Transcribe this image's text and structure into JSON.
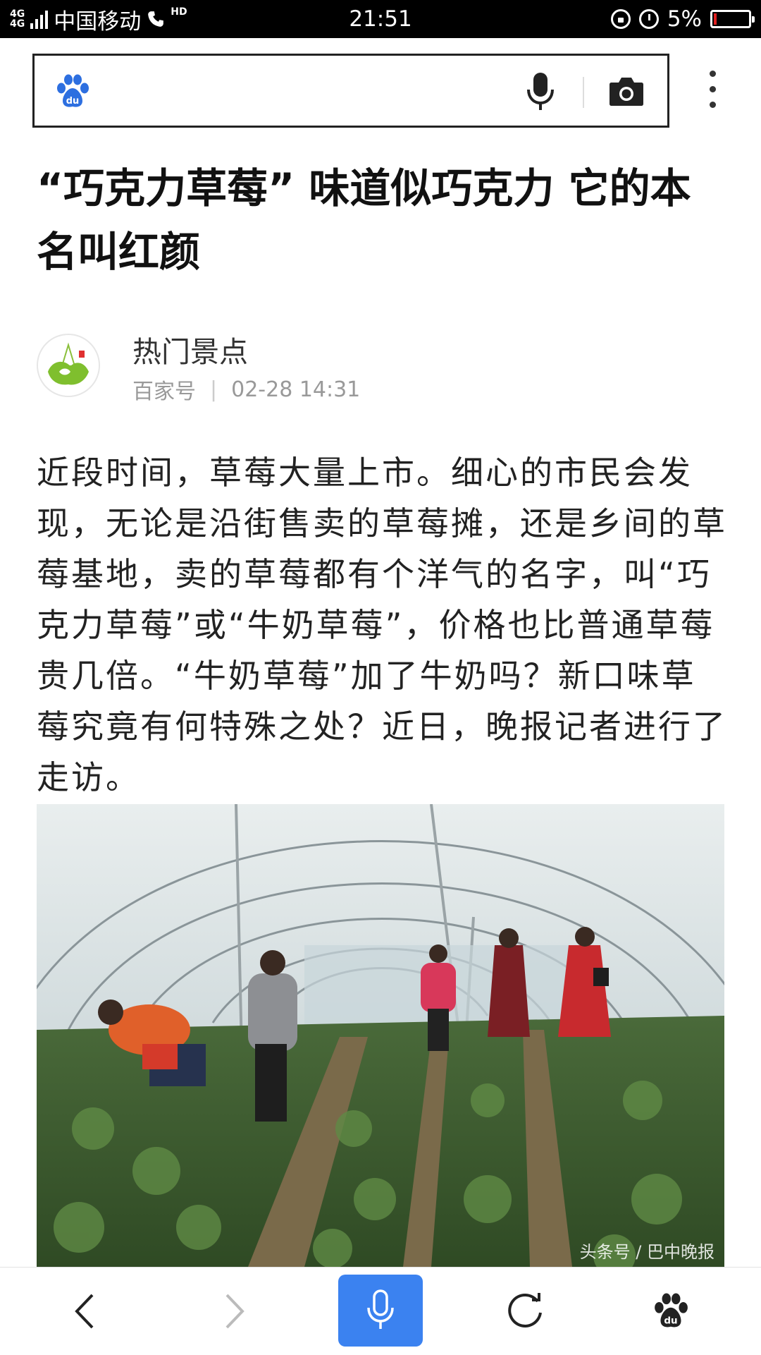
{
  "status_bar": {
    "network_top": "4G",
    "network_bottom": "4G",
    "carrier": "中国移动",
    "hd": "HD",
    "time": "21:51",
    "battery_text": "5%",
    "battery_level_fraction": 0.05,
    "battery_color": "#e02020",
    "icons": [
      "signal-icon",
      "call-icon",
      "lock-rotation-icon",
      "alarm-icon",
      "battery-icon"
    ]
  },
  "search": {
    "value": "",
    "icons": [
      "baidu-paw-icon",
      "microphone-icon",
      "camera-icon",
      "more-vertical-icon"
    ]
  },
  "article": {
    "title": "“巧克力草莓” 味道似巧克力 它的本名叫红颜",
    "author": {
      "name": "热门景点",
      "source": "百家号",
      "separator": "|",
      "datetime": "02-28 14:31"
    },
    "body": "近段时间，草莓大量上市。细心的市民会发现，无论是沿街售卖的草莓摊，还是乡间的草莓基地，卖的草莓都有个洋气的名字，叫“巧克力草莓”或“牛奶草莓”，价格也比普通草莓贵几倍。“牛奶草莓”加了牛奶吗？新口味草莓究竟有何特殊之处？近日，晚报记者进行了走访。",
    "image_watermark": "头条号 / 巴中晚报"
  },
  "bottom_nav": {
    "items": [
      "back-icon",
      "forward-icon",
      "voice-search-icon",
      "refresh-icon",
      "baidu-home-icon"
    ],
    "accent": "#3b82f0"
  }
}
